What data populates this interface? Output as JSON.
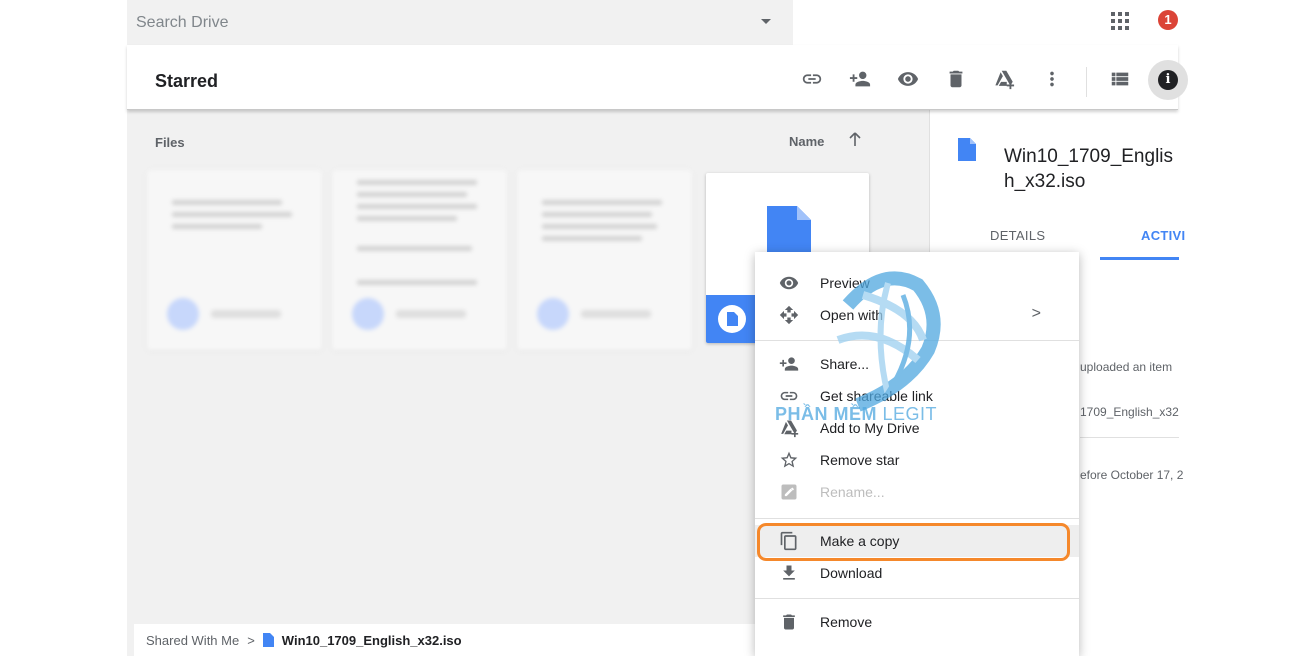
{
  "search": {
    "placeholder": "Search Drive"
  },
  "notifications": {
    "count": "1"
  },
  "header": {
    "title": "Starred",
    "toolbar_icons": [
      "link-icon",
      "add-person-icon",
      "eye-icon",
      "trash-icon",
      "add-to-drive-icon",
      "more-vert-icon",
      "list-view-icon",
      "info-icon"
    ],
    "info_glyph": "i"
  },
  "files": {
    "section_label": "Files",
    "sort_label": "Name",
    "sort_direction_icon": "arrow-up-icon"
  },
  "breadcrumb": {
    "parent": "Shared With Me",
    "separator": ">",
    "current": "Win10_1709_English_x32.iso"
  },
  "details": {
    "file_name": "Win10_1709_English_x32.iso",
    "tabs": [
      "DETAILS",
      "ACTIVITY"
    ],
    "tab_details": "DETAILS",
    "tab_activity": "ACTIVI",
    "activity_text_1": "uploaded an item",
    "activity_text_2": "1709_English_x32",
    "activity_text_3": "efore October 17, 2"
  },
  "context_menu": {
    "preview": "Preview",
    "open_with": "Open with",
    "open_with_arrow": ">",
    "share": "Share...",
    "get_link": "Get shareable link",
    "add_to_drive": "Add to My Drive",
    "remove_star": "Remove star",
    "rename": "Rename...",
    "make_copy": "Make a copy",
    "download": "Download",
    "remove": "Remove"
  },
  "watermark": {
    "bold": "PHẦN MỀM",
    "light": "LEGIT"
  },
  "colors": {
    "accent": "#4285f4",
    "highlight": "#f5882b",
    "badge": "#db4437"
  }
}
